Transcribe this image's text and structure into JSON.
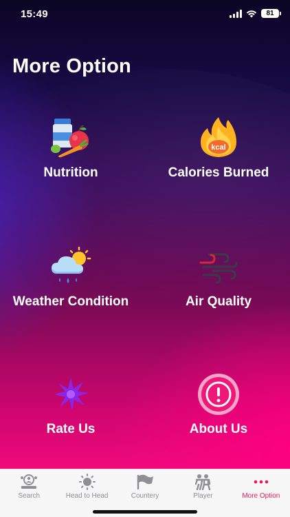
{
  "status_bar": {
    "time": "15:49",
    "battery": "81"
  },
  "page": {
    "title": "More Option"
  },
  "options": [
    {
      "id": "nutrition",
      "label": "Nutrition",
      "icon": "nutrition-food-icon"
    },
    {
      "id": "calories",
      "label": "Calories Burned",
      "icon": "kcal-flame-icon"
    },
    {
      "id": "weather",
      "label": "Weather Condition",
      "icon": "weather-cloud-sun-icon"
    },
    {
      "id": "air",
      "label": "Air Quality",
      "icon": "wind-icon"
    },
    {
      "id": "rate",
      "label": "Rate Us",
      "icon": "star-burst-icon"
    },
    {
      "id": "about",
      "label": "About Us",
      "icon": "info-exclamation-icon"
    }
  ],
  "calorie_icon_text": "kcal",
  "tabs": [
    {
      "label": "Search",
      "icon": "search-user-icon",
      "active": false
    },
    {
      "label": "Head to Head",
      "icon": "sun-icon",
      "active": false
    },
    {
      "label": "Countery",
      "icon": "flag-icon",
      "active": false
    },
    {
      "label": "Player",
      "icon": "players-icon",
      "active": false
    },
    {
      "label": "More Option",
      "icon": "more-dots-icon",
      "active": true
    }
  ],
  "colors": {
    "accent": "#e8175d",
    "tab_inactive": "#8e8e93",
    "about_icon": "#f0177a",
    "rate_icon": "#8b25e8"
  }
}
